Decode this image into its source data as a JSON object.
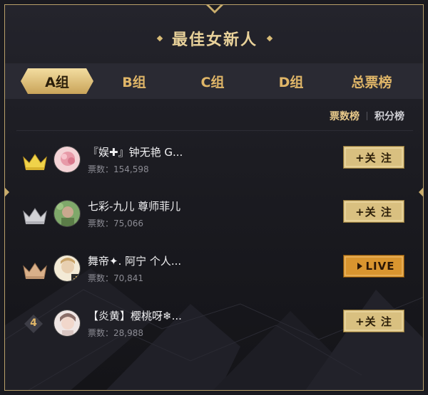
{
  "title": "最佳女新人",
  "tabs": [
    {
      "label": "A组",
      "active": true
    },
    {
      "label": "B组",
      "active": false
    },
    {
      "label": "C组",
      "active": false
    },
    {
      "label": "D组",
      "active": false
    },
    {
      "label": "总票榜",
      "active": false
    }
  ],
  "sort_toggle": {
    "votes_label": "票数榜",
    "points_label": "积分榜",
    "active": "votes"
  },
  "entries": [
    {
      "rank": 1,
      "rank_icon": "gold-crown-icon",
      "name": "『娱✚』钟无艳 G...",
      "votes_text": "票数：154,598",
      "button": "+关 注",
      "button_type": "follow"
    },
    {
      "rank": 2,
      "rank_icon": "silver-crown-icon",
      "name": "七彩-九儿 尊师菲儿",
      "votes_text": "票数：75,066",
      "button": "+关 注",
      "button_type": "follow"
    },
    {
      "rank": 3,
      "rank_icon": "bronze-crown-icon",
      "name": "舞帝✦. 阿宁 个人...",
      "votes_text": "票数：70,841",
      "button": "LIVE",
      "button_type": "live"
    },
    {
      "rank": 4,
      "rank_icon": "rank-number-badge",
      "rank_label": "4",
      "name": "【炎黄】樱桃呀❄...",
      "votes_text": "票数：28,988",
      "button": "+关 注",
      "button_type": "follow"
    }
  ],
  "colors": {
    "gold": "#e0b668",
    "gold_light": "#e9d29a",
    "button_gold": "#d9c080",
    "live_orange": "#d9952f",
    "border": "#b9a06a"
  }
}
